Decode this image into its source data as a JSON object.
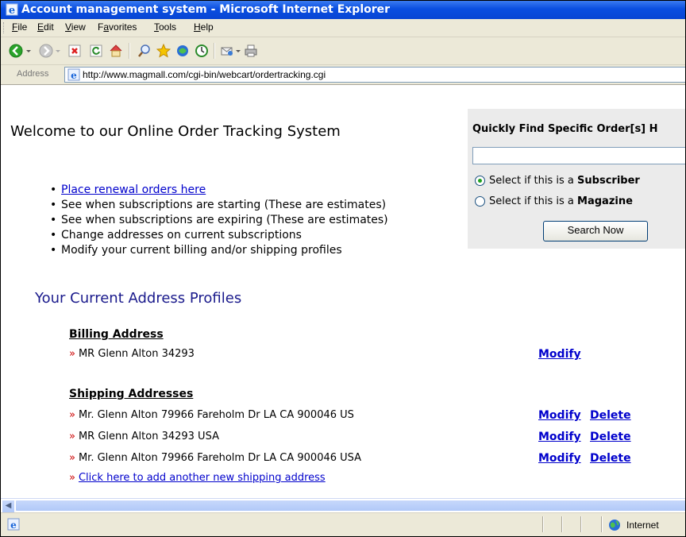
{
  "window": {
    "title": "Account management system - Microsoft Internet Explorer"
  },
  "menu": [
    "File",
    "Edit",
    "View",
    "Favorites",
    "Tools",
    "Help"
  ],
  "menu_accel": [
    "F",
    "E",
    "V",
    "a",
    "T",
    "H"
  ],
  "toolbar": [
    "back-icon",
    "forward-icon",
    "stop-icon",
    "refresh-icon",
    "home-icon",
    "search-icon",
    "favorites-icon",
    "media-icon",
    "history-icon",
    "mail-icon",
    "print-icon"
  ],
  "address": {
    "label": "Address",
    "url": "http://www.magmall.com/cgi-bin/webcart/ordertracking.cgi"
  },
  "page": {
    "welcome_title": "Welcome to our Online Order Tracking System",
    "features": [
      "Place renewal orders here",
      "See when subscriptions are starting (These are estimates)",
      "See when subscriptions are expiring (These are estimates)",
      "Change addresses on current subscriptions",
      "Modify your current billing and/or shipping profiles"
    ],
    "quick_find": {
      "title": "Quickly Find Specific Order[s] H",
      "search_value": "",
      "radio_prefix": "Select if this is a",
      "radio_options": [
        {
          "label": "Subscriber",
          "checked": true
        },
        {
          "label": "Magazine",
          "checked": false
        }
      ],
      "button": "Search Now"
    },
    "profiles_heading": "Your Current Address Profiles",
    "billing": {
      "heading": "Billing Address",
      "addresses": [
        {
          "text": "MR Glenn Alton 34293",
          "actions": [
            "Modify"
          ]
        }
      ]
    },
    "shipping": {
      "heading": "Shipping Addresses",
      "addresses": [
        {
          "text": "Mr. Glenn Alton 79966 Fareholm Dr LA CA 900046 US",
          "actions": [
            "Modify",
            "Delete"
          ]
        },
        {
          "text": "MR Glenn Alton 34293 USA",
          "actions": [
            "Modify",
            "Delete"
          ]
        },
        {
          "text": "Mr. Glenn Alton 79966 Fareholm Dr LA CA 900046 USA",
          "actions": [
            "Modify",
            "Delete"
          ]
        }
      ],
      "add_link": "Click here to add another new shipping address"
    }
  },
  "status": {
    "zone": "Internet"
  },
  "colors": {
    "link": "#0000cc",
    "heading": "#1a1a8c",
    "arrow": "#cc0000",
    "panel": "#ebebeb"
  }
}
